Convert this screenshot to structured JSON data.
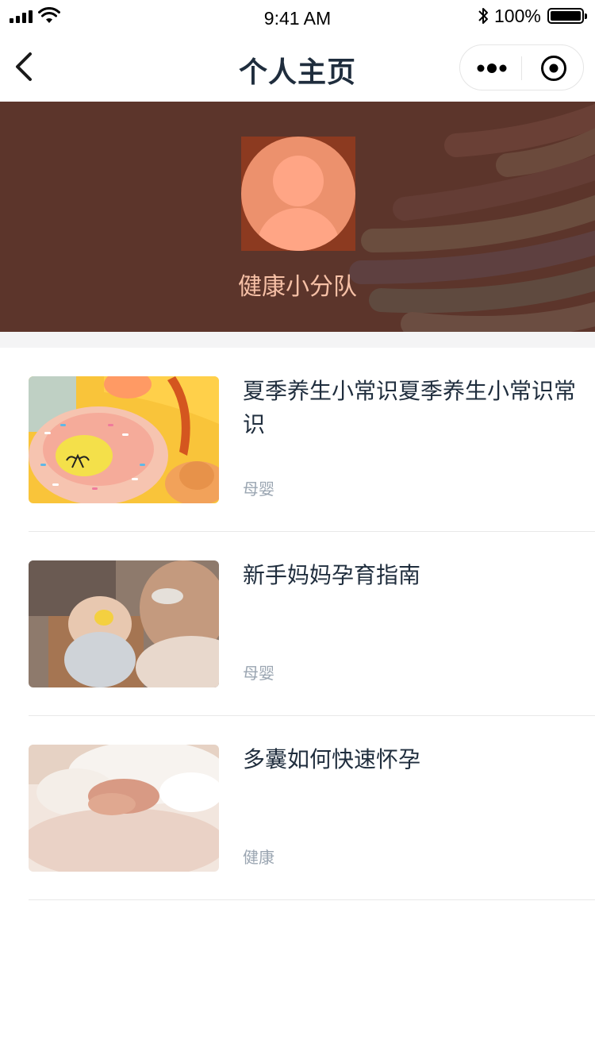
{
  "status_bar": {
    "time": "9:41 AM",
    "battery_percent": "100%"
  },
  "nav": {
    "title": "个人主页",
    "back_icon": "chevron-left-icon",
    "more_icon": "more-dots-icon",
    "close_icon": "target-circle-icon"
  },
  "profile": {
    "username": "健康小分队",
    "banner_color": "#5c352b",
    "name_color": "#f6c0a6"
  },
  "articles": [
    {
      "title": "夏季养生小常识夏季养生小常识常识",
      "category": "母婴"
    },
    {
      "title": "新手妈妈孕育指南",
      "category": "母婴"
    },
    {
      "title": "多囊如何快速怀孕",
      "category": "健康"
    }
  ],
  "colors": {
    "title_text": "#1f2d3d",
    "tag_text": "#9aa5b1"
  }
}
